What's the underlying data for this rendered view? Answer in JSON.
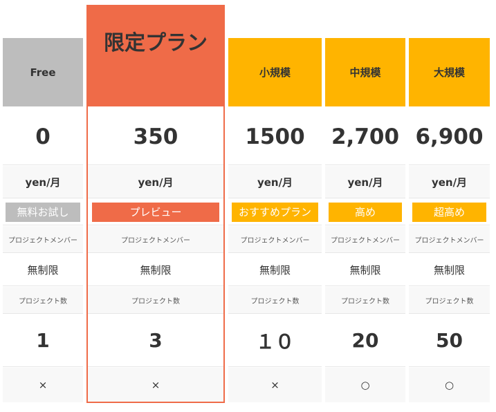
{
  "colors": {
    "free_header": "#bdbdbd",
    "limited_accent": "#ef6b48",
    "plan_accent": "#ffb400",
    "tag_free": "#bdbdbd",
    "text": "#333333",
    "row_alt": "#f8f8f8"
  },
  "plans": [
    {
      "name": "Free",
      "price": "0",
      "unit": "yen/月",
      "tag": "無料お試し",
      "member_label": "プロジェクトメンバー",
      "member_value": "無制限",
      "project_label": "プロジェクト数",
      "project_value": "1",
      "mark": "×"
    },
    {
      "name": "限定プラン",
      "price": "350",
      "unit": "yen/月",
      "tag": "プレビュー",
      "member_label": "プロジェクトメンバー",
      "member_value": "無制限",
      "project_label": "プロジェクト数",
      "project_value": "3",
      "mark": "×"
    },
    {
      "name": "小規模",
      "price": "1500",
      "unit": "yen/月",
      "tag": "おすすめプラン",
      "member_label": "プロジェクトメンバー",
      "member_value": "無制限",
      "project_label": "プロジェクト数",
      "project_value": "１０",
      "mark": "×"
    },
    {
      "name": "中規模",
      "price": "2,700",
      "unit": "yen/月",
      "tag": "高め",
      "member_label": "プロジェクトメンバー",
      "member_value": "無制限",
      "project_label": "プロジェクト数",
      "project_value": "20",
      "mark": "○"
    },
    {
      "name": "大規模",
      "price": "6,900",
      "unit": "yen/月",
      "tag": "超高め",
      "member_label": "プロジェクトメンバー",
      "member_value": "無制限",
      "project_label": "プロジェクト数",
      "project_value": "50",
      "mark": "○"
    }
  ]
}
